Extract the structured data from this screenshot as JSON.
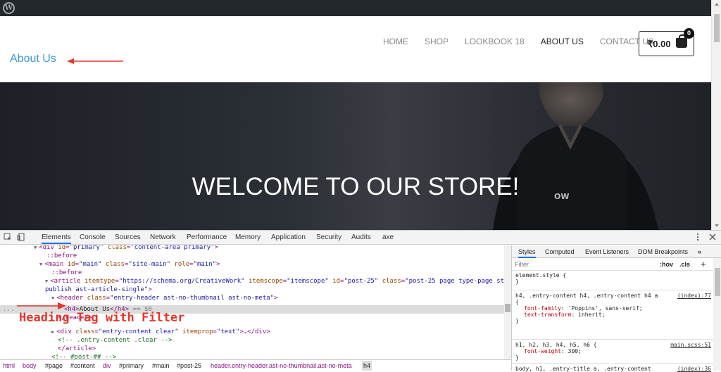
{
  "wp_logo": "W",
  "header": {
    "page_title": "About Us",
    "nav": [
      "HOME",
      "SHOP",
      "LOOKBOOK 18",
      "ABOUT US",
      "CONTACT US"
    ],
    "active_nav": "ABOUT US",
    "cart_amount": "₹0.00",
    "cart_count": "0"
  },
  "hero": {
    "title": "WELCOME TO OUR STORE!",
    "shirt_logo": "OW"
  },
  "devtools": {
    "tabs": [
      "Elements",
      "Console",
      "Sources",
      "Network",
      "Performance",
      "Memory",
      "Application",
      "Security",
      "Audits",
      "axe"
    ],
    "active_tab": "Elements",
    "dom": {
      "l0": {
        "tag": "<div ",
        "a1": "id",
        "v1": "\"primary\"",
        "a2": " class",
        "v2": "\"content-area primary\"",
        "end": ">"
      },
      "l1": "::before",
      "l2": {
        "tag": "<main ",
        "a1": "id",
        "v1": "\"main\"",
        "a2": " class",
        "v2": "\"site-main\"",
        "a3": " role",
        "v3": "\"main\"",
        "end": ">"
      },
      "l3": "::before",
      "l4": {
        "tag": "<article ",
        "a1": "itemtype",
        "v1": "\"https://schema.org/CreativeWork\"",
        "a2": " itemscope",
        "v2": "\"itemscope\"",
        "a3": " id",
        "v3": "\"post-25\"",
        "a4": " class",
        "v4": "\"post-25 page type-page status-"
      },
      "l5": {
        "cont": "publish ast-article-single\"",
        "end": ">"
      },
      "l6": {
        "tag": "<header ",
        "a1": "class",
        "v1": "\"entry-header ast-no-thumbnail ast-no-meta\"",
        "end": ">"
      },
      "l7": {
        "open": "<h4>",
        "text": "About Us",
        "close": "</h4>",
        "eq": " == $0"
      },
      "l8": "</header>",
      "l9": {
        "tag": "<div ",
        "a1": "class",
        "v1": "\"entry-content clear\"",
        "a2": " itemprop",
        "v2": "\"text\"",
        "end": ">…</div>"
      },
      "l10": "<!-- .entry-content .clear -->",
      "l11": "</article>",
      "l12": "<!-- #post-## -->"
    },
    "annotation": "Heading Tag with Filter",
    "breadcrumbs": [
      "html",
      "body",
      "#page",
      "#content",
      "div",
      "#primary",
      "#main",
      "#post-25",
      "header.entry-header.ast-no-thumbnail.ast-no-meta",
      "h4"
    ],
    "styles": {
      "tabs": [
        "Styles",
        "Computed",
        "Event Listeners",
        "DOM Breakpoints"
      ],
      "active_tab": "Styles",
      "filter_placeholder": "Filter",
      "hov": ":hov",
      "cls": ".cls",
      "plus": "+",
      "rules": [
        {
          "selector": "element.style {",
          "source": "",
          "props": [],
          "close": "}"
        },
        {
          "selector": "h4, .entry-content h4, .entry-content h4 a",
          "source": "(index):77",
          "open": "{",
          "props": [
            {
              "name": "font-family",
              "value": "'Poppins', sans-serif;"
            },
            {
              "name": "text-transform",
              "value": "inherit;"
            }
          ],
          "close": "}"
        },
        {
          "selector": "h1, h2, h3, h4, h5, h6 {",
          "source": "main.scss:51",
          "props": [
            {
              "name": "font-weight",
              "value": "300;"
            }
          ],
          "close": "}"
        },
        {
          "selector": "body, h1, .entry-title a, .entry-content",
          "source": "(index):36",
          "props": [],
          "close": ""
        }
      ]
    }
  },
  "colors": {
    "accent_title": "#3a9bd5",
    "annotation_red": "#e8352a",
    "devtools_blue": "#1a73e8"
  }
}
